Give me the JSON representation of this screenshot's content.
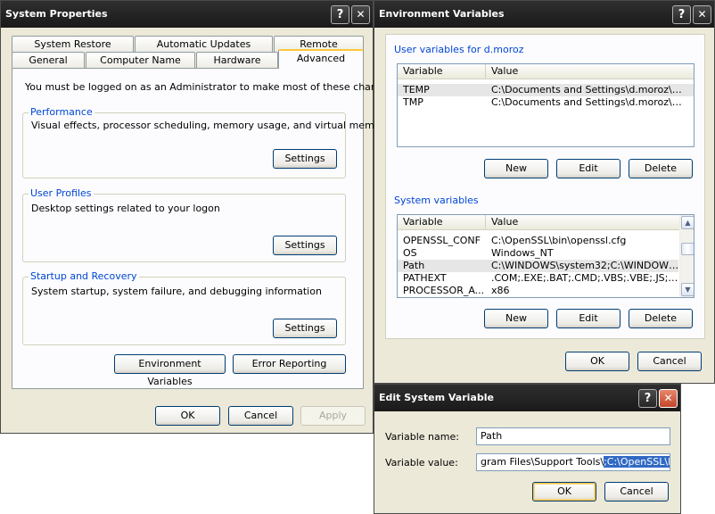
{
  "system_properties": {
    "title": "System Properties",
    "help_glyph": "?",
    "close_glyph": "✕",
    "tabs_row1": [
      "System Restore",
      "Automatic Updates",
      "Remote"
    ],
    "tabs_row2": [
      "General",
      "Computer Name",
      "Hardware",
      "Advanced"
    ],
    "admin_note": "You must be logged on as an Administrator to make most of these changes.",
    "performance": {
      "title": "Performance",
      "desc": "Visual effects, processor scheduling, memory usage, and virtual memory",
      "button": "Settings"
    },
    "user_profiles": {
      "title": "User Profiles",
      "desc": "Desktop settings related to your logon",
      "button": "Settings"
    },
    "startup_recovery": {
      "title": "Startup and Recovery",
      "desc": "System startup, system failure, and debugging information",
      "button": "Settings"
    },
    "env_button": "Environment Variables",
    "error_button": "Error Reporting",
    "ok": "OK",
    "cancel": "Cancel",
    "apply": "Apply"
  },
  "environment_variables": {
    "title": "Environment Variables",
    "help_glyph": "?",
    "close_glyph": "✕",
    "user_group_title": "User variables for d.moroz",
    "columns": [
      "Variable",
      "Value"
    ],
    "user_rows": [
      {
        "variable": "TEMP",
        "value": "C:\\Documents and Settings\\d.moroz\\Lo..."
      },
      {
        "variable": "TMP",
        "value": "C:\\Documents and Settings\\d.moroz\\Lo..."
      }
    ],
    "system_group_title": "System variables",
    "system_rows": [
      {
        "variable": "OPENSSL_CONF",
        "value": "C:\\OpenSSL\\bin\\openssl.cfg"
      },
      {
        "variable": "OS",
        "value": "Windows_NT"
      },
      {
        "variable": "Path",
        "value": "C:\\WINDOWS\\system32;C:\\WINDOWS;..."
      },
      {
        "variable": "PATHEXT",
        "value": ".COM;.EXE;.BAT;.CMD;.VBS;.VBE;.JS;...."
      },
      {
        "variable": "PROCESSOR_A...",
        "value": "x86"
      }
    ],
    "new": "New",
    "edit": "Edit",
    "delete": "Delete",
    "ok": "OK",
    "cancel": "Cancel"
  },
  "edit_system_variable": {
    "title": "Edit System Variable",
    "help_glyph": "?",
    "close_glyph": "✕",
    "name_label": "Variable name:",
    "name_value": "Path",
    "value_label": "Variable value:",
    "value_prefix": "gram Files\\Support Tools\\",
    "value_selected": ";C:\\OpenSSL\\bin",
    "ok": "OK",
    "cancel": "Cancel"
  }
}
